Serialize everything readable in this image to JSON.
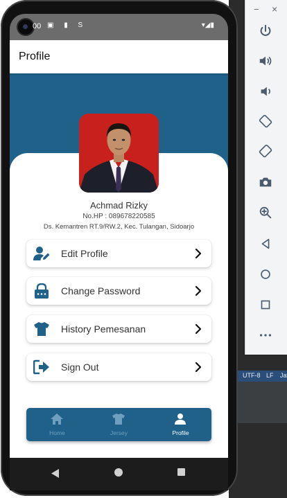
{
  "status_bar": {
    "time": "00",
    "icons": "▣ ▮ S"
  },
  "app_bar": {
    "title": "Profile"
  },
  "profile": {
    "name": "Achmad Rizky",
    "phone": "No.HP : 089678220585",
    "address": "Ds. Kemantren RT.9/RW.2, Kec. Tulangan, Sidoarjo"
  },
  "menu": [
    {
      "label": "Edit Profile",
      "icon": "edit-user-icon"
    },
    {
      "label": "Change Password",
      "icon": "lock-icon"
    },
    {
      "label": "History Pemesanan",
      "icon": "jersey-icon"
    },
    {
      "label": "Sign Out",
      "icon": "sign-out-icon"
    }
  ],
  "bottom_nav": [
    {
      "label": "Home",
      "icon": "home-icon",
      "active": false
    },
    {
      "label": "Jersey",
      "icon": "jersey-icon",
      "active": false
    },
    {
      "label": "Profile",
      "icon": "person-icon",
      "active": true
    }
  ],
  "ide_status": {
    "encoding": "UTF-8",
    "line_sep": "LF",
    "lang": "Jav"
  },
  "colors": {
    "primary": "#1f6189",
    "avatar_bg": "#c8201c",
    "inactive_nav": "#6f9fbf"
  }
}
